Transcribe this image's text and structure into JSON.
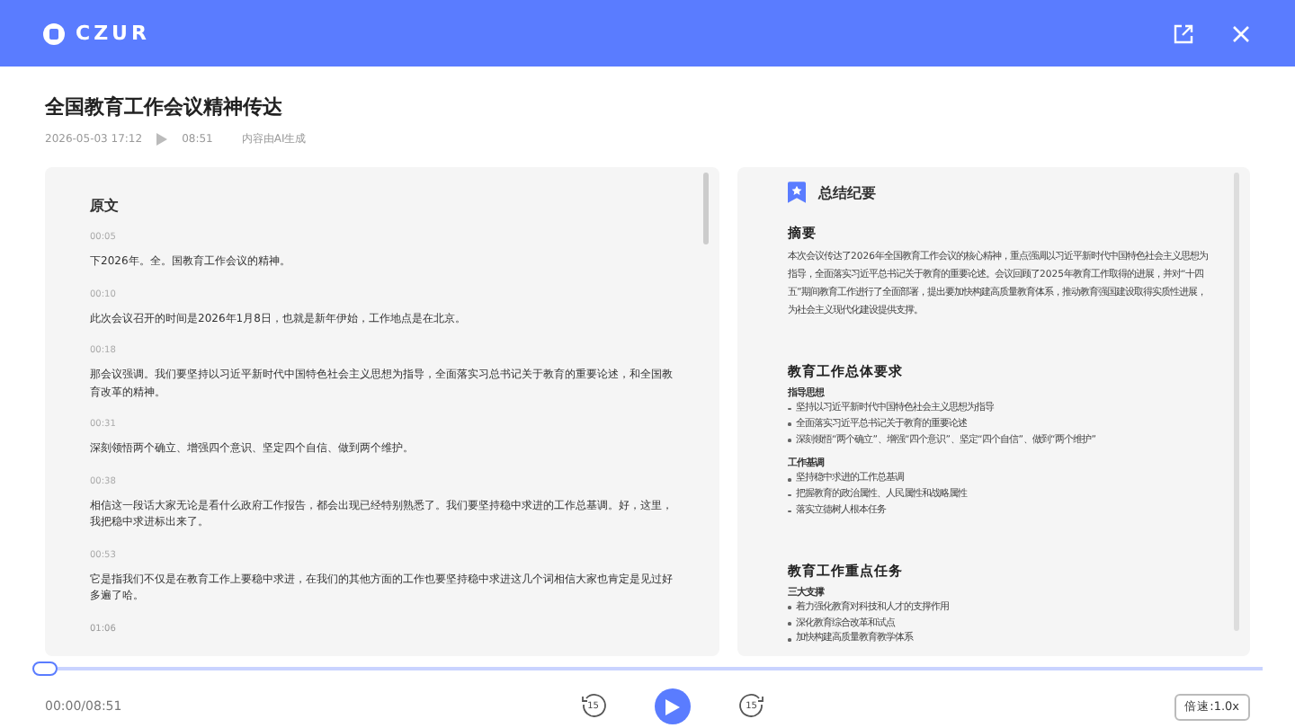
{
  "header": {
    "logo": "CZUR"
  },
  "doc": {
    "title": "全国教育工作会议精神传达",
    "datetime": "2026-05-03 17:12",
    "duration": "08:51",
    "note": "内容由AI生成"
  },
  "transcript": {
    "title": "原文",
    "entries": [
      {
        "time": "00:05",
        "text": "下2026年。全。国教育工作会议的精神。"
      },
      {
        "time": "00:10",
        "text": "此次会议召开的时间是2026年1月8日，也就是新年伊始，工作地点是在北京。"
      },
      {
        "time": "00:18",
        "text": "那会议强调。我们要坚持以习近平新时代中国特色社会主义思想为指导，全面落实习总书记关于教育的重要论述，和全国教育改革的精神。"
      },
      {
        "time": "00:31",
        "text": "深刻领悟两个确立、增强四个意识、坚定四个自信、做到两个维护。"
      },
      {
        "time": "00:38",
        "text": "相信这一段话大家无论是看什么政府工作报告，都会出现已经特别熟悉了。我们要坚持稳中求进的工作总基调。好，这里，我把稳中求进标出来了。"
      },
      {
        "time": "00:53",
        "text": "它是指我们不仅是在教育工作上要稳中求进，在我们的其他方面的工作也要坚持稳中求进这几个词相信大家也肯定是见过好多遍了哈。"
      },
      {
        "time": "01:06"
      }
    ]
  },
  "summary": {
    "title": "总结纪要",
    "sections": [
      {
        "heading": "摘要",
        "paragraph": "本次会议传达了2026年全国教育工作会议的核心精神，重点强调以习近平新时代中国特色社会主义思想为指导，全面落实习近平总书记关于教育的重要论述。会议回顾了2025年教育工作取得的进展，并对“十四五”期间教育工作进行了全面部署，提出要加快构建高质量教育体系，推动教育强国建设取得实质性进展，为社会主义现代化建设提供支撑。"
      },
      {
        "heading": "教育工作总体要求",
        "groups": [
          {
            "subheading": "指导思想",
            "bullets": [
              "坚持以习近平新时代中国特色社会主义思想为指导",
              "全面落实习近平总书记关于教育的重要论述",
              "深刻领悟“两个确立”、增强“四个意识”、坚定“四个自信”、做到“两个维护”"
            ]
          },
          {
            "subheading": "工作基调",
            "bullets": [
              "坚持稳中求进的工作总基调",
              "把握教育的政治属性、人民属性和战略属性",
              "落实立德树人根本任务"
            ]
          }
        ]
      },
      {
        "heading": "教育工作重点任务",
        "groups": [
          {
            "subheading": "三大支撑",
            "bullets": [
              "着力强化教育对科技和人才的支撑作用",
              "深化教育综合改革和试点",
              "加快构建高质量教育教学体系"
            ]
          }
        ]
      }
    ]
  },
  "player": {
    "level": 0,
    "time": "00:00/08:51",
    "back_label": "15",
    "forward_label": "15",
    "speed": "倍速:1.0x"
  }
}
